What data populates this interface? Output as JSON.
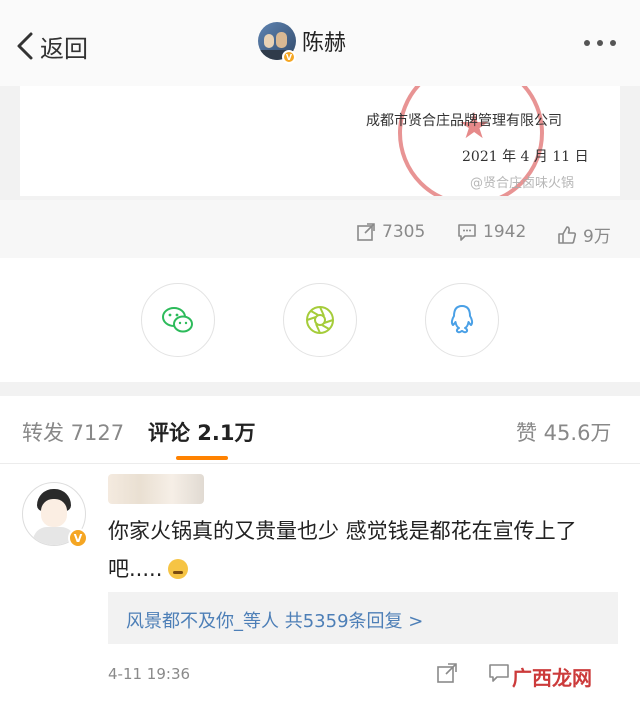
{
  "header": {
    "back_label": "返回",
    "title": "陈赫",
    "verified_badge": "V"
  },
  "letter": {
    "company": "成都市贤合庄品牌管理有限公司",
    "date": "2021 年 4 月 11 日",
    "watermark": "@贤合庄卤味火锅"
  },
  "stats": {
    "repost": "7305",
    "comment": "1942",
    "like": "9万"
  },
  "share": {
    "items": [
      "wechat-icon",
      "moments-icon",
      "qq-icon"
    ],
    "colors": {
      "wechat": "#2dbb5b",
      "moments": "#a5cc3a",
      "qq": "#4aa0e6"
    }
  },
  "tabs": {
    "repost": "转发 7127",
    "comment": "评论 2.1万",
    "like": "赞 45.6万",
    "active_color": "#ff8200"
  },
  "comment": {
    "text": "你家火锅真的又贵量也少 感觉钱是都花在宣传上了吧.....",
    "reply_summary": "风景都不及你_等人  共5359条回复 >",
    "time": "4-11 19:36",
    "verified_badge": "V",
    "site_watermark": "广西龙网"
  },
  "colors": {
    "accent": "#ff8200",
    "link": "#4d7fb7",
    "badge": "#f5a623"
  }
}
